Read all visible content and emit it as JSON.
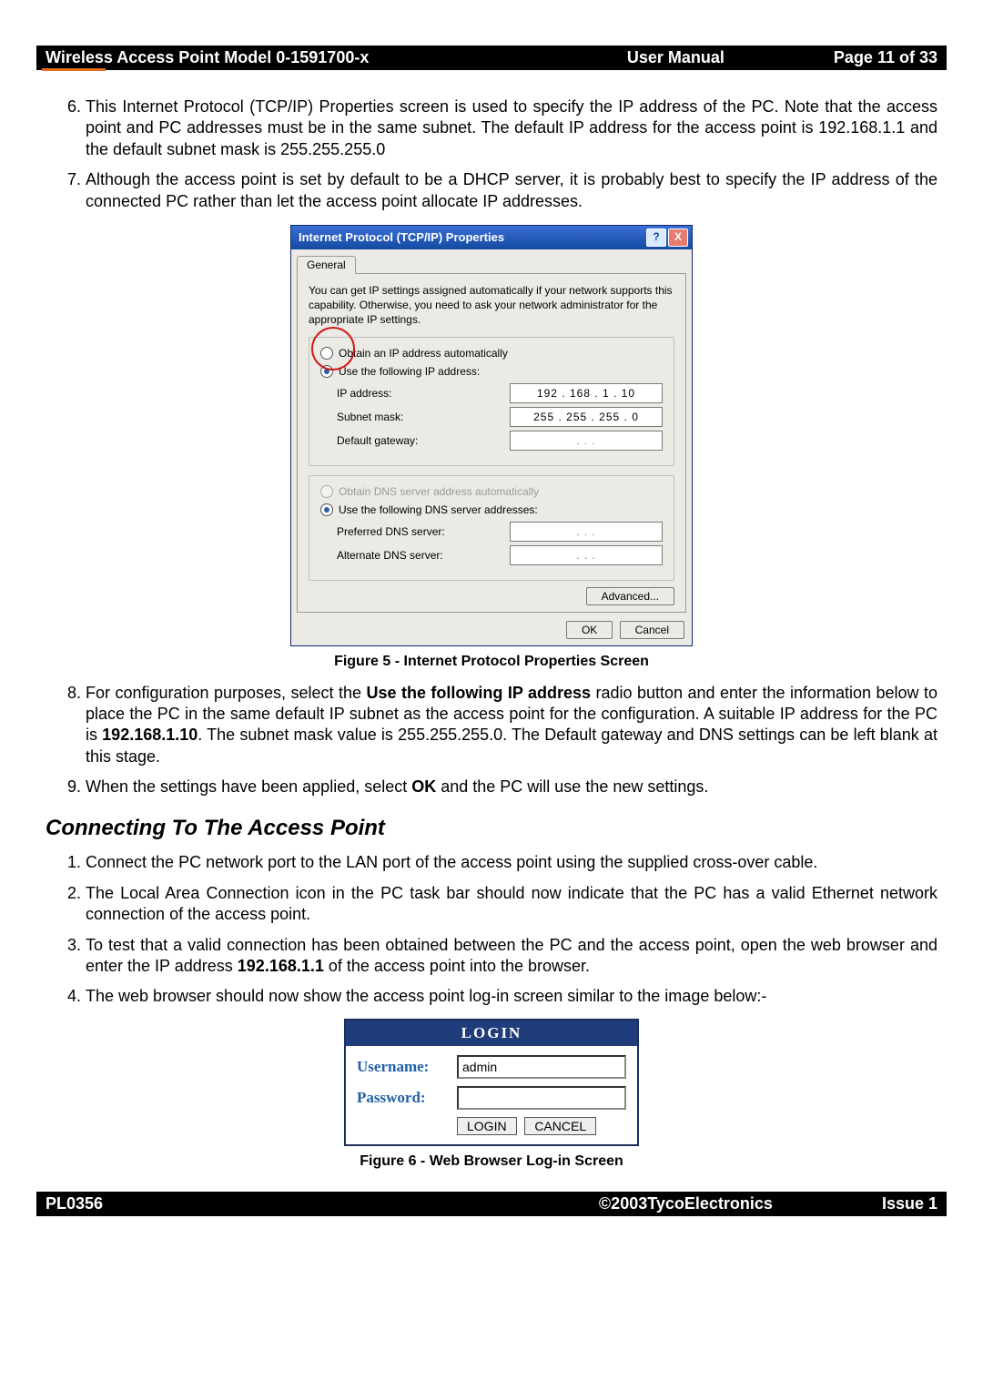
{
  "header": {
    "left": "Wireless Access Point  Model 0-1591700-x",
    "mid": "User Manual",
    "right": "Page 11 of 33"
  },
  "footer": {
    "left": "PL0356",
    "mid": "©2003TycoElectronics",
    "right": "Issue 1"
  },
  "items6_7": {
    "n6": "This Internet Protocol (TCP/IP) Properties screen is used to specify the IP address of the PC. Note that the access point and PC addresses must be in the same subnet. The default IP address for the access point is 192.168.1.1 and the default subnet mask is 255.255.255.0",
    "n7": "Although the access point is set by default to be a DHCP server, it is probably best to specify the IP address of the connected PC rather than let the access point allocate IP addresses."
  },
  "tcpip": {
    "title": "Internet Protocol (TCP/IP) Properties",
    "tab": "General",
    "info": "You can get IP settings assigned automatically if your network supports this capability. Otherwise, you need to ask your network administrator for the appropriate IP settings.",
    "r_ip_auto": "Obtain an IP address automatically",
    "r_ip_manual": "Use the following IP address:",
    "lbl_ip": "IP address:",
    "lbl_subnet": "Subnet mask:",
    "lbl_gw": "Default gateway:",
    "val_ip": "192 . 168 .  1  .  10",
    "val_subnet": "255 . 255 . 255 .  0",
    "val_gw": ".       .       .",
    "r_dns_auto": "Obtain DNS server address automatically",
    "r_dns_manual": "Use the following DNS server addresses:",
    "lbl_pdns": "Preferred DNS server:",
    "lbl_adns": "Alternate DNS server:",
    "val_pdns": ".       .       .",
    "val_adns": ".       .       .",
    "btn_adv": "Advanced...",
    "btn_ok": "OK",
    "btn_cancel": "Cancel"
  },
  "fig5": "Figure 5 - Internet Protocol Properties Screen",
  "items8_9": {
    "n8_a": "For configuration purposes, select the ",
    "n8_b": "Use the following IP address",
    "n8_c": " radio button and enter the information below to place the PC in the same default IP subnet as the access point for the configuration. A suitable IP address for the PC is ",
    "n8_d": "192.168.1.10",
    "n8_e": ". The subnet mask value is 255.255.255.0. The Default gateway and DNS settings can be left blank at this stage.",
    "n9_a": "When the settings have been applied, select ",
    "n9_b": "OK",
    "n9_c": " and the PC will use the new settings."
  },
  "section2": "Connecting To The Access Point",
  "conn": {
    "n1": "Connect the PC network port to the LAN port of the access point using the supplied cross-over cable.",
    "n2": "The Local Area Connection icon in the PC task bar should now indicate that the PC has a valid Ethernet network connection of the access point.",
    "n3_a": "To test that a valid connection has been obtained between the PC and the access point, open the web browser and enter the IP address ",
    "n3_b": "192.168.1.1",
    "n3_c": " of the access point into the browser.",
    "n4": "The web browser should now show the access point log-in screen similar to the image below:-"
  },
  "login": {
    "title": "LOGIN",
    "user_lbl": "Username:",
    "pass_lbl": "Password:",
    "user_val": "admin",
    "btn_login": "LOGIN",
    "btn_cancel": "CANCEL"
  },
  "fig6": "Figure 6 - Web Browser Log-in Screen"
}
